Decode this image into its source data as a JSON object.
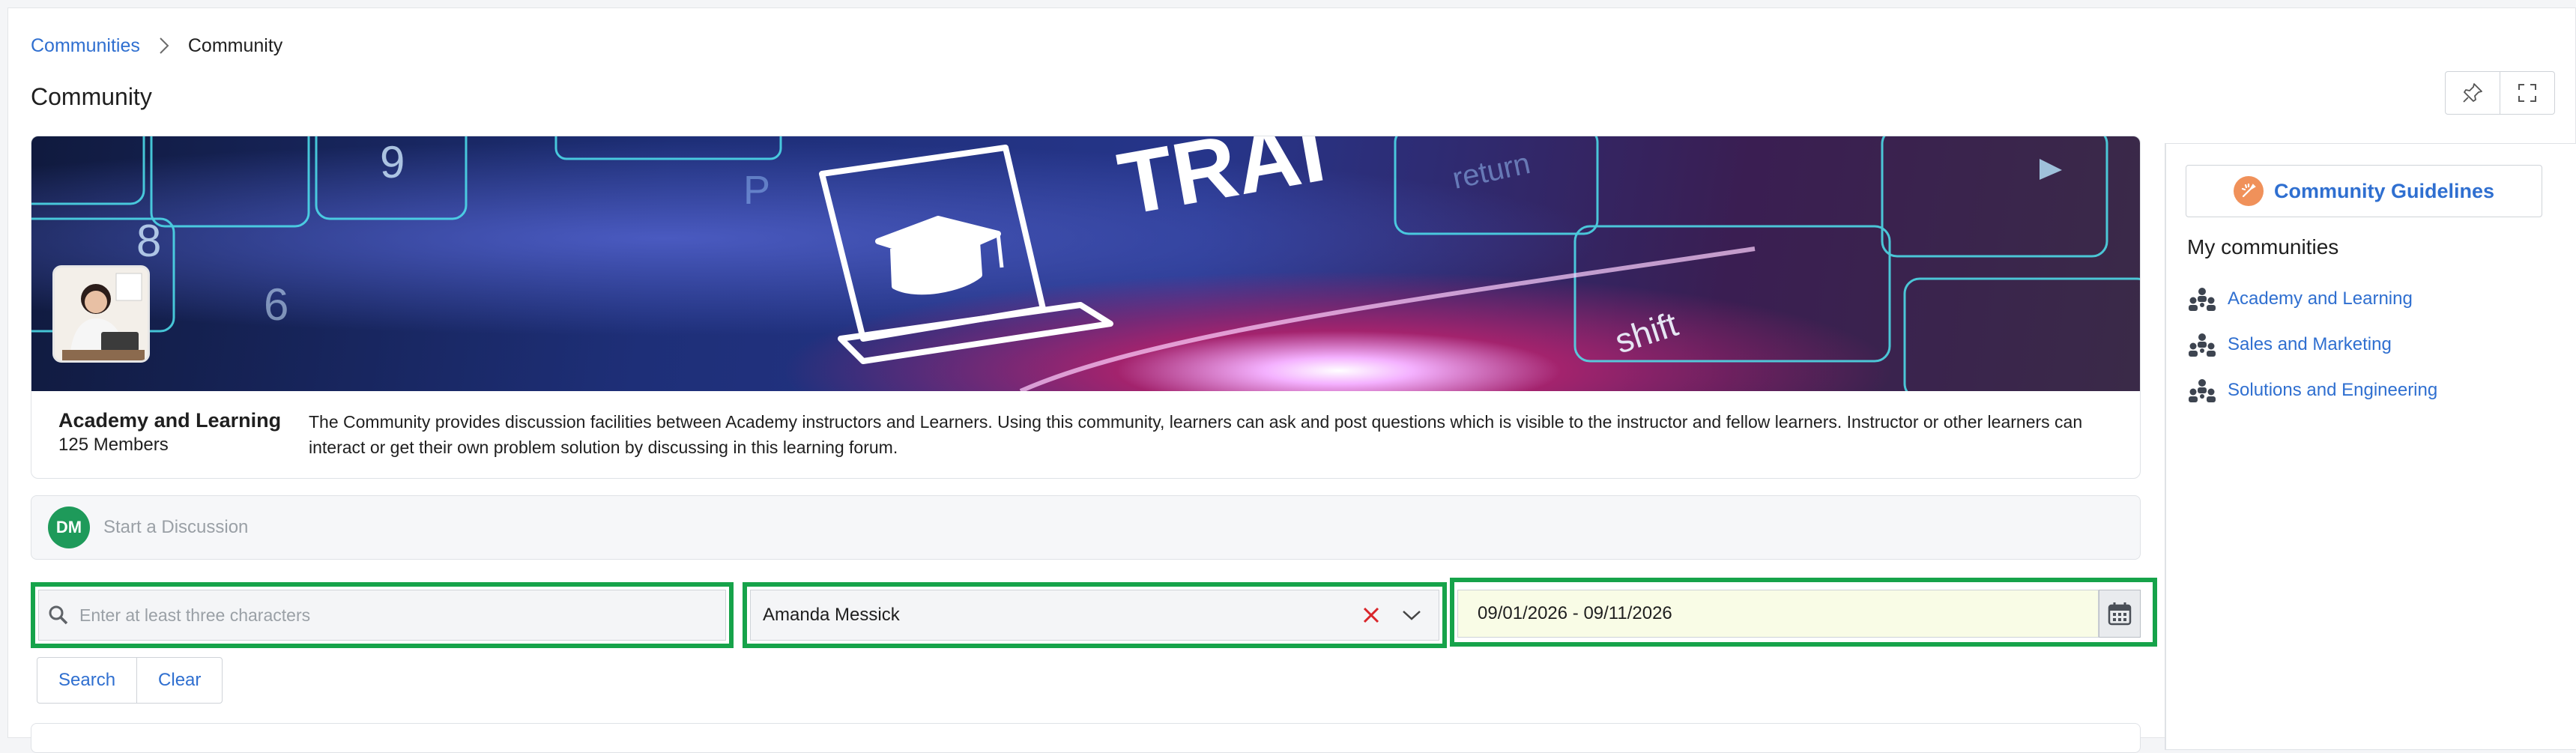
{
  "breadcrumb": {
    "parent": "Communities",
    "current": "Community"
  },
  "page_title": "Community",
  "community": {
    "name": "Academy and Learning",
    "members": "125 Members",
    "description": "The Community provides discussion facilities between Academy instructors and Learners. Using this community, learners can ask and post questions which is visible to the instructor and fellow learners. Instructor or other learners can interact or get their own problem solution by discussing in this learning forum.",
    "banner_text": "TRAI",
    "key_label": "shift",
    "return_label": "return"
  },
  "discussion": {
    "avatar_initials": "DM",
    "placeholder": "Start a Discussion"
  },
  "filters": {
    "search_placeholder": "Enter at least three characters",
    "author_value": "Amanda Messick",
    "date_range": "09/01/2026 - 09/11/2026"
  },
  "buttons": {
    "search": "Search",
    "clear": "Clear"
  },
  "sidebar": {
    "guidelines_label": "Community Guidelines",
    "heading": "My communities",
    "items": [
      {
        "label": "Academy and Learning"
      },
      {
        "label": "Sales and Marketing"
      },
      {
        "label": "Solutions and Engineering"
      }
    ]
  },
  "colors": {
    "link": "#2f6fd0",
    "highlight": "#16a34a",
    "avatar": "#1e9a5a",
    "guideline_icon": "#f0915a"
  }
}
